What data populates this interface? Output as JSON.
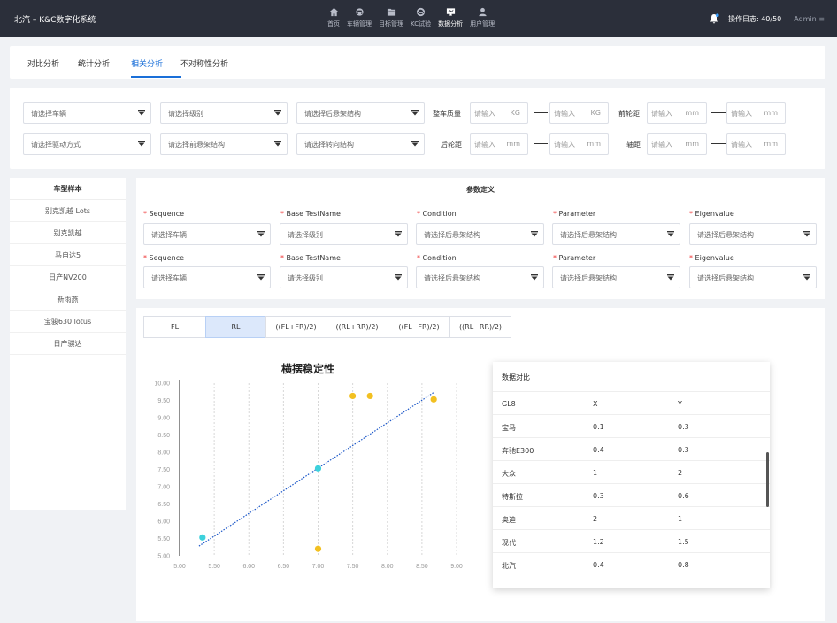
{
  "app": {
    "title": "北汽 – K&C数字化系统"
  },
  "nav": [
    {
      "label": "首页",
      "icon": "home-icon"
    },
    {
      "label": "车辆管理",
      "icon": "car-icon"
    },
    {
      "label": "目标管理",
      "icon": "folder-icon"
    },
    {
      "label": "KC试验",
      "icon": "wheel-icon"
    },
    {
      "label": "数据分析",
      "icon": "monitor-icon",
      "active": true
    },
    {
      "label": "用户管理",
      "icon": "user-icon"
    }
  ],
  "topright": {
    "log": "操作日志: 40/50",
    "user": "Admin ≡"
  },
  "tabs": [
    {
      "label": "对比分析"
    },
    {
      "label": "统计分析"
    },
    {
      "label": "相关分析",
      "active": true
    },
    {
      "label": "不对称性分析"
    }
  ],
  "filters": {
    "vehicle": "请选择车辆",
    "level": "请选择级别",
    "rear_susp": "请选择后悬架结构",
    "drive": "请选择驱动方式",
    "front_susp": "请选择前悬架结构",
    "steering": "请选择转向结构",
    "mass_label": "整车质量",
    "front_track_label": "前轮距",
    "rear_track_label": "后轮距",
    "wheelbase_label": "轴距",
    "input_placeholder": "请输入",
    "unit_kg": "KG",
    "unit_mm": "mm"
  },
  "samples": {
    "header": "车型样本",
    "items": [
      "别克凯越 Lots",
      "别克凯越",
      "马自达5",
      "日产NV200",
      "新雨燕",
      "宝骏630 lotus",
      "日产骐达"
    ]
  },
  "params": {
    "title": "参数定义",
    "labels": [
      "Sequence",
      "Base TestName",
      "Condition",
      "Parameter",
      "Eigenvalue"
    ],
    "req": "*",
    "row_values": [
      "请选择车辆",
      "请选择级别",
      "请选择后悬架结构",
      "请选择后悬架结构",
      "请选择后悬架结构"
    ]
  },
  "segments": [
    {
      "label": "FL"
    },
    {
      "label": "RL",
      "active": true
    },
    {
      "label": "((FL+FR)/2)"
    },
    {
      "label": "((RL+RR)/2)"
    },
    {
      "label": "((FL−FR)/2)"
    },
    {
      "label": "((RL−RR)/2)"
    }
  ],
  "chart_data": {
    "type": "scatter",
    "title": "横摆稳定性",
    "xlim": [
      5.0,
      9.0
    ],
    "ylim": [
      5.0,
      10.0
    ],
    "x_ticks": [
      "5.00",
      "5.50",
      "6.00",
      "6.50",
      "7.00",
      "7.50",
      "8.00",
      "8.50",
      "9.00"
    ],
    "y_ticks": [
      "5.00",
      "5.50",
      "6.00",
      "6.50",
      "7.00",
      "7.50",
      "8.00",
      "8.50",
      "9.00",
      "9.50",
      "10.00"
    ],
    "grid": "vertical dashed",
    "series": [
      {
        "color": "#3dd1dc",
        "points": [
          [
            5.33,
            5.53
          ],
          [
            7.0,
            7.53
          ]
        ]
      },
      {
        "color": "#f2c021",
        "points": [
          [
            7.5,
            9.63
          ],
          [
            7.75,
            9.63
          ],
          [
            8.67,
            9.53
          ],
          [
            7.0,
            5.2
          ]
        ]
      }
    ],
    "trendline": {
      "color": "#1a56c8",
      "from": [
        5.28,
        5.28
      ],
      "to": [
        8.67,
        9.73
      ]
    }
  },
  "data_compare": {
    "title": "数据对比",
    "header": [
      "GL8",
      "X",
      "Y"
    ],
    "rows": [
      [
        "宝马",
        "0.1",
        "0.3"
      ],
      [
        "奔驰E300",
        "0.4",
        "0.3"
      ],
      [
        "大众",
        "1",
        "2"
      ],
      [
        "特斯拉",
        "0.3",
        "0.6"
      ],
      [
        "奥迪",
        "2",
        "1"
      ],
      [
        "现代",
        "1.2",
        "1.5"
      ],
      [
        "北汽",
        "0.4",
        "0.8"
      ]
    ]
  }
}
